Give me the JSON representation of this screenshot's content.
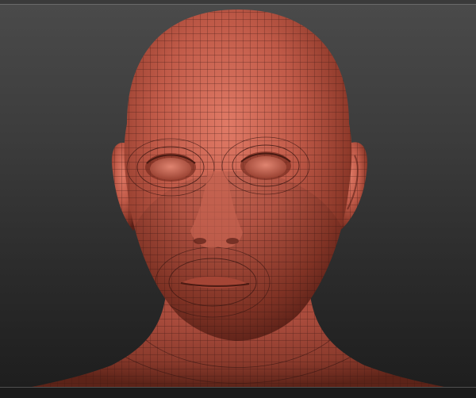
{
  "app": {
    "window_title": ""
  },
  "viewport": {
    "model": "sculpted-head-mesh",
    "material_color": "#c05a48",
    "wireframe_color": "#3b1712",
    "background_top": "#4a4a4a",
    "background_bottom": "#1e1e1e"
  }
}
